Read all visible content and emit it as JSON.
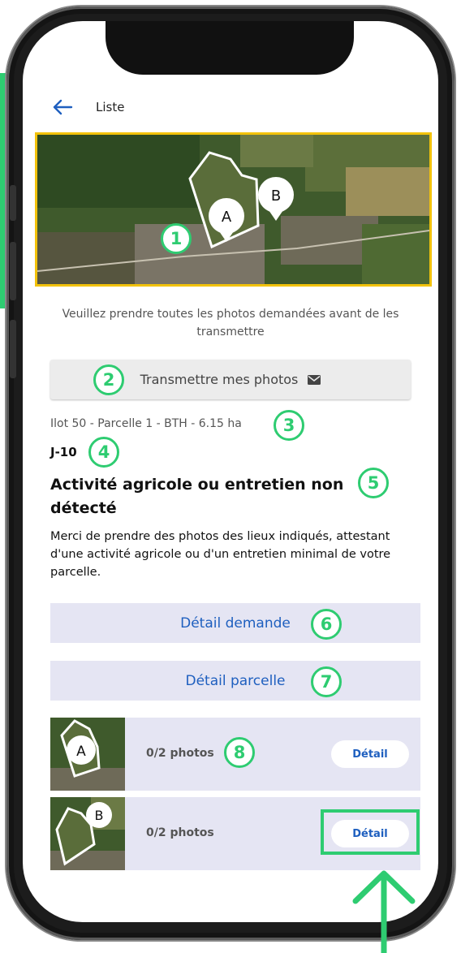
{
  "header": {
    "back_icon": "arrow-left-icon",
    "title": "Liste"
  },
  "map": {
    "marker_a": "A",
    "marker_b": "B",
    "frame_color": "#f2c20b"
  },
  "instruction": "Veuillez prendre toutes les photos demandées avant de les transmettre",
  "send_button": {
    "label": "Transmettre mes photos",
    "icon": "envelope-icon"
  },
  "parcel": {
    "info": "Ilot 50 - Parcelle 1 - BTH - 6.15 ha",
    "deadline": "J-10",
    "title": "Activité agricole ou entretien non détecté",
    "description": "Merci de prendre des photos des lieux indiqués, attestant d'une activité agricole ou d'un entretien minimal de votre parcelle."
  },
  "actions": {
    "detail_request": "Détail demande",
    "detail_parcel": "Détail parcelle"
  },
  "photo_rows": [
    {
      "marker": "A",
      "count": "0/2 photos",
      "button": "Détail"
    },
    {
      "marker": "B",
      "count": "0/2 photos",
      "button": "Détail"
    }
  ],
  "annotations": [
    "1",
    "2",
    "3",
    "4",
    "5",
    "6",
    "7",
    "8"
  ],
  "colors": {
    "accent_blue": "#1e5fbf",
    "annotation_green": "#2ecc71",
    "row_bg": "#e5e5f3"
  }
}
